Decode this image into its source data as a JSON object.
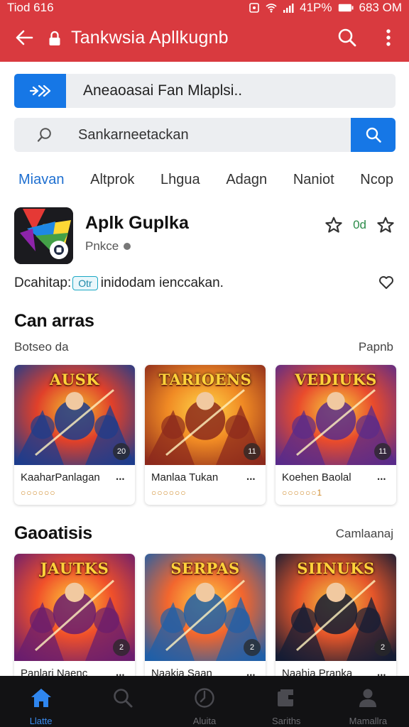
{
  "status_bar": {
    "time": "Tiod 616",
    "battery": "41P%",
    "clock_right": "683 OM"
  },
  "app_bar": {
    "title": "Tankwsia Apllkugnb"
  },
  "promo": {
    "text": "Aneaoasai Fan Mlaplsi.."
  },
  "search": {
    "placeholder": "Sankarneetackan"
  },
  "tabs": [
    {
      "label": "Miavan",
      "active": true
    },
    {
      "label": "Altprok",
      "active": false
    },
    {
      "label": "Lhgua",
      "active": false
    },
    {
      "label": "Adagn",
      "active": false
    },
    {
      "label": "Naniot",
      "active": false
    },
    {
      "label": "Ncop",
      "active": false
    }
  ],
  "app": {
    "name": "Aplk Guplka",
    "developer": "Pnkce",
    "rating": "0d"
  },
  "description": {
    "before": "Dcahitap:",
    "chip": "Otr",
    "after": "inidodam ienccakan."
  },
  "section1": {
    "title": "Can arras",
    "subtitle": "Botseo da",
    "link": "Papnb",
    "cards": [
      {
        "title": "KaaharPanlagan",
        "rating": "○○○○○○",
        "badge": "20",
        "art_text": "AUSK",
        "palette": [
          "#1d3c8c",
          "#e0402a",
          "#f2c230"
        ]
      },
      {
        "title": "Manlaa Tukan",
        "rating": "○○○○○○",
        "badge": "11",
        "art_text": "TARIOENS",
        "palette": [
          "#8c2a1c",
          "#f08a24",
          "#ffd84a"
        ]
      },
      {
        "title": "Koehen Baolal",
        "rating": "○○○○○○1",
        "badge": "11",
        "art_text": "VEDIUKS",
        "palette": [
          "#5a2b8a",
          "#e94b2c",
          "#f7d23e"
        ]
      }
    ]
  },
  "section2": {
    "title": "Gaoatisis",
    "link": "Camlaanaj",
    "cards": [
      {
        "title": "Panlari Naenc",
        "badge": "2",
        "art_text": "JAUTKS",
        "palette": [
          "#6a1d6e",
          "#f0502a",
          "#ffcf3a"
        ]
      },
      {
        "title": "Naakia Saan",
        "badge": "2",
        "art_text": "SERPAS",
        "palette": [
          "#1f5fa8",
          "#f2662e",
          "#ffd045"
        ]
      },
      {
        "title": "Naahia Pranka",
        "badge": "2",
        "art_text": "SIINUKS",
        "palette": [
          "#141c34",
          "#e5562a",
          "#f5c542"
        ]
      }
    ]
  },
  "bottom_nav": [
    {
      "label": "Llatte",
      "icon": "home-icon",
      "active": true
    },
    {
      "label": "",
      "icon": "search-icon",
      "active": false
    },
    {
      "label": "Aluita",
      "icon": "clock-icon",
      "active": false
    },
    {
      "label": "Sariths",
      "icon": "games-icon",
      "active": false
    },
    {
      "label": "Mamallra",
      "icon": "profile-icon",
      "active": false
    }
  ],
  "colors": {
    "brand_red": "#d93a3f",
    "accent_blue": "#1677e6",
    "active_tab": "#1e6fd0",
    "nav_bg": "#121214"
  }
}
